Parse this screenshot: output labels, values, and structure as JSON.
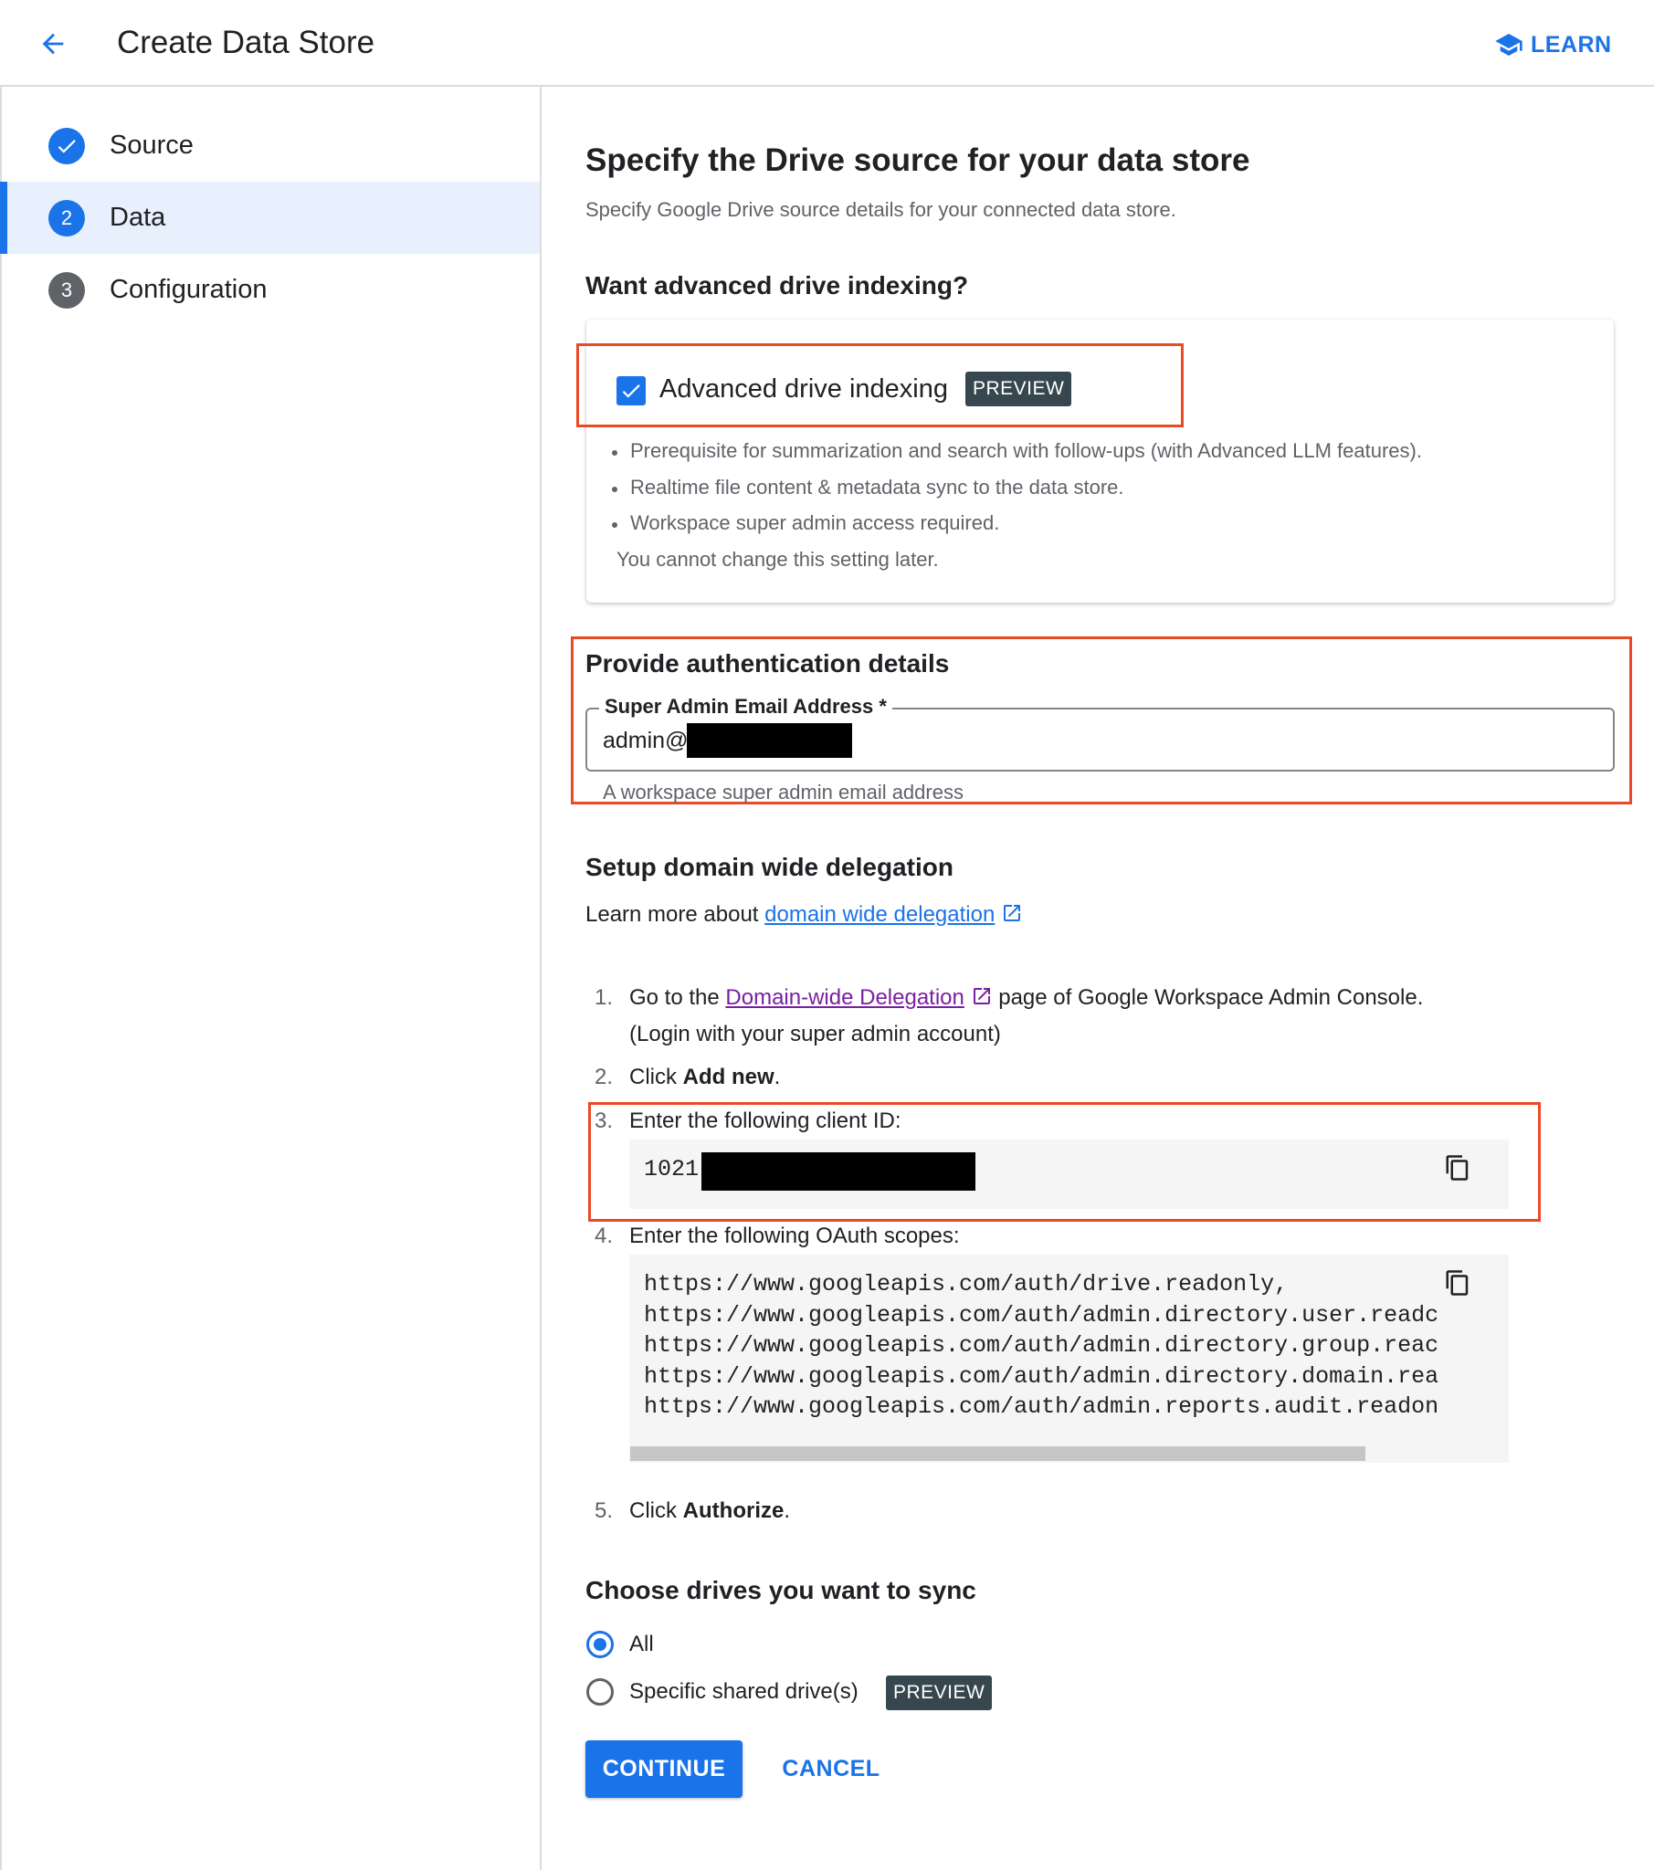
{
  "header": {
    "title": "Create Data Store",
    "learn_label": "LEARN"
  },
  "stepper": {
    "steps": [
      {
        "number": "",
        "label": "Source",
        "state": "done"
      },
      {
        "number": "2",
        "label": "Data",
        "state": "active"
      },
      {
        "number": "3",
        "label": "Configuration",
        "state": "pending"
      }
    ]
  },
  "main": {
    "title": "Specify the Drive source for your data store",
    "subtitle": "Specify Google Drive source details for your connected data store.",
    "advanced": {
      "heading": "Want advanced drive indexing?",
      "checkbox_label": "Advanced drive indexing",
      "checked": true,
      "badge": "PREVIEW",
      "bullets": [
        "Prerequisite for summarization and search with follow-ups (with Advanced LLM features).",
        "Realtime file content & metadata sync to the data store.",
        "Workspace super admin access required."
      ],
      "note": "You cannot change this setting later."
    },
    "auth": {
      "heading": "Provide authentication details",
      "field_label": "Super Admin Email Address *",
      "field_value": "admin@",
      "helper": "A workspace super admin email address"
    },
    "delegation": {
      "heading": "Setup domain wide delegation",
      "learn_prefix": "Learn more about ",
      "learn_link": "domain wide delegation",
      "steps": [
        {
          "num": "1.",
          "prefix": "Go to the ",
          "link": "Domain-wide Delegation",
          "suffix": " page of Google Workspace Admin Console.",
          "line2": "(Login with your super admin account)"
        },
        {
          "num": "2.",
          "prefix": "Click ",
          "bold": "Add new",
          "suffix": "."
        },
        {
          "num": "3.",
          "text": "Enter the following client ID:",
          "code": "1021"
        },
        {
          "num": "4.",
          "text": "Enter the following OAuth scopes:",
          "code_lines": [
            "https://www.googleapis.com/auth/drive.readonly,",
            "https://www.googleapis.com/auth/admin.directory.user.readc",
            "https://www.googleapis.com/auth/admin.directory.group.reac",
            "https://www.googleapis.com/auth/admin.directory.domain.rea",
            "https://www.googleapis.com/auth/admin.reports.audit.readon"
          ]
        },
        {
          "num": "5.",
          "prefix": "Click ",
          "bold": "Authorize",
          "suffix": "."
        }
      ]
    },
    "drives": {
      "heading": "Choose drives you want to sync",
      "options": [
        {
          "label": "All",
          "selected": true
        },
        {
          "label": "Specific shared drive(s)",
          "selected": false,
          "badge": "PREVIEW"
        }
      ]
    },
    "actions": {
      "continue": "CONTINUE",
      "cancel": "CANCEL"
    }
  },
  "colors": {
    "accent": "#1a73e8",
    "highlight_border": "#ea4a26",
    "badge_bg": "#37474f",
    "active_step_bg": "#e8f0fe"
  },
  "icons": [
    "arrow-back-icon",
    "school-icon",
    "check-circle-icon",
    "open-in-new-icon",
    "copy-icon"
  ]
}
